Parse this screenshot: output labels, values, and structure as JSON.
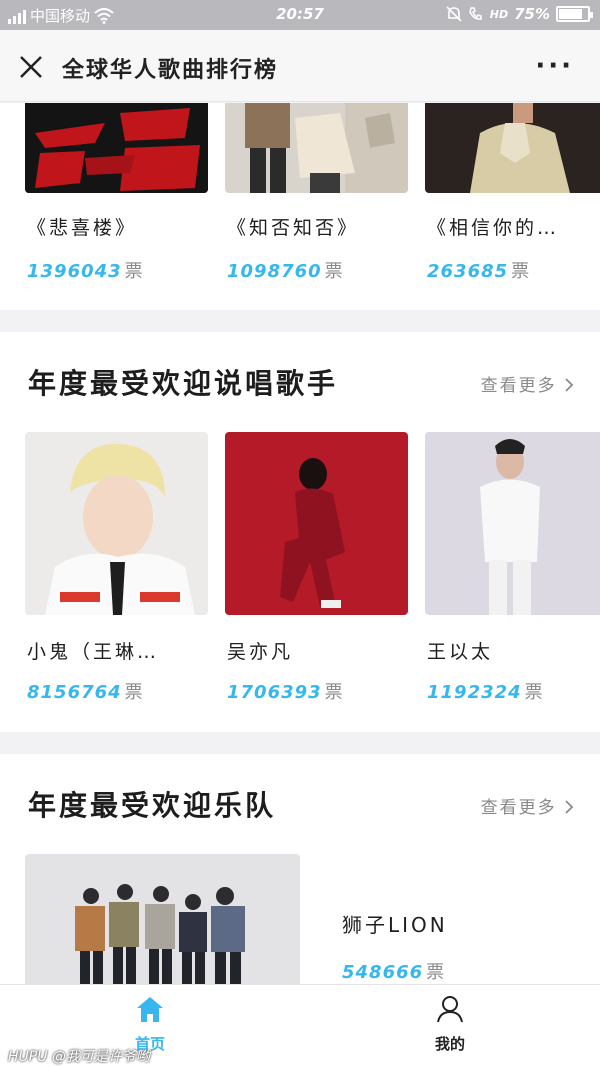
{
  "status_bar": {
    "carrier": "中国移动",
    "network": "4G",
    "time": "20:57",
    "hd": "HD",
    "battery": "75%"
  },
  "header": {
    "title": "全球华人歌曲排行榜"
  },
  "songs_section": {
    "items": [
      {
        "name": "《悲喜楼》",
        "votes": "1396043",
        "unit": "票"
      },
      {
        "name": "《知否知否》",
        "votes": "1098760",
        "unit": "票"
      },
      {
        "name": "《相信你的…",
        "votes": "263685",
        "unit": "票"
      }
    ]
  },
  "rapper_section": {
    "title": "年度最受欢迎说唱歌手",
    "see_more": "查看更多",
    "items": [
      {
        "name": "小鬼（王琳…",
        "votes": "8156764",
        "unit": "票"
      },
      {
        "name": "吴亦凡",
        "votes": "1706393",
        "unit": "票"
      },
      {
        "name": "王以太",
        "votes": "1192324",
        "unit": "票"
      }
    ]
  },
  "band_section": {
    "title": "年度最受欢迎乐队",
    "see_more": "查看更多",
    "item": {
      "name": "狮子LION",
      "votes": "548666",
      "unit": "票"
    }
  },
  "bottom_nav": {
    "home": "首页",
    "mine": "我的"
  },
  "watermark": "HUPU @我可是许爷哟",
  "colors": {
    "accent": "#36b7ee",
    "text": "#222222",
    "muted": "#8a8a8a"
  }
}
